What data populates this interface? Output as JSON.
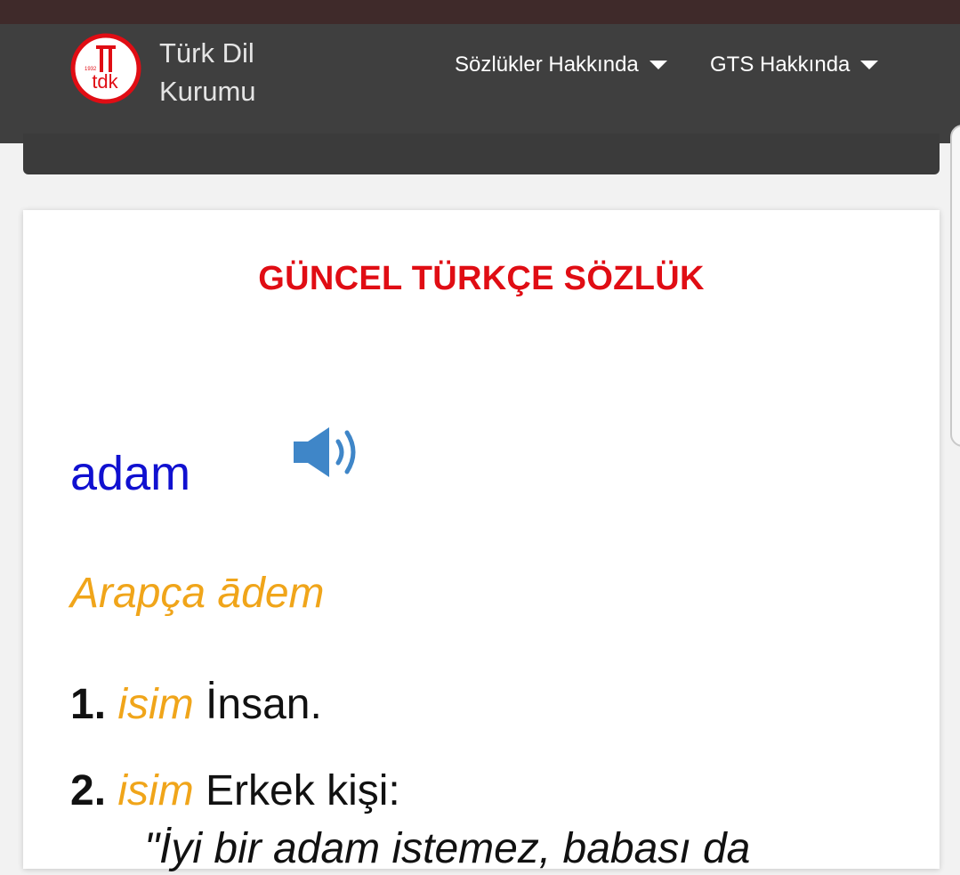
{
  "header": {
    "logo_name": [
      "Türk Dil",
      "Kurumu"
    ],
    "logo_mark": "tdk",
    "logo_year": "1932",
    "nav": [
      {
        "label": "Sözlükler Hakkında",
        "icon": "caret-down-icon"
      },
      {
        "label": "GTS Hakkında",
        "icon": "caret-down-icon"
      }
    ]
  },
  "main": {
    "dictionary_title": "GÜNCEL TÜRKÇE SÖZLÜK",
    "headword": "adam",
    "audio_icon": "speaker-icon",
    "origin": "Arapça ādem",
    "senses": [
      {
        "number": "1.",
        "pos": "isim",
        "definition": "İnsan."
      },
      {
        "number": "2.",
        "pos": "isim",
        "definition": "Erkek kişi:"
      }
    ],
    "example_partial": "\"İyi bir adam istemez, babası da"
  },
  "colors": {
    "title_red": "#e00d14",
    "headword_blue": "#1010d0",
    "accent_orange": "#f0a51a",
    "navbar_bg": "#3f3f3f",
    "speaker_blue": "#3f86c8"
  }
}
